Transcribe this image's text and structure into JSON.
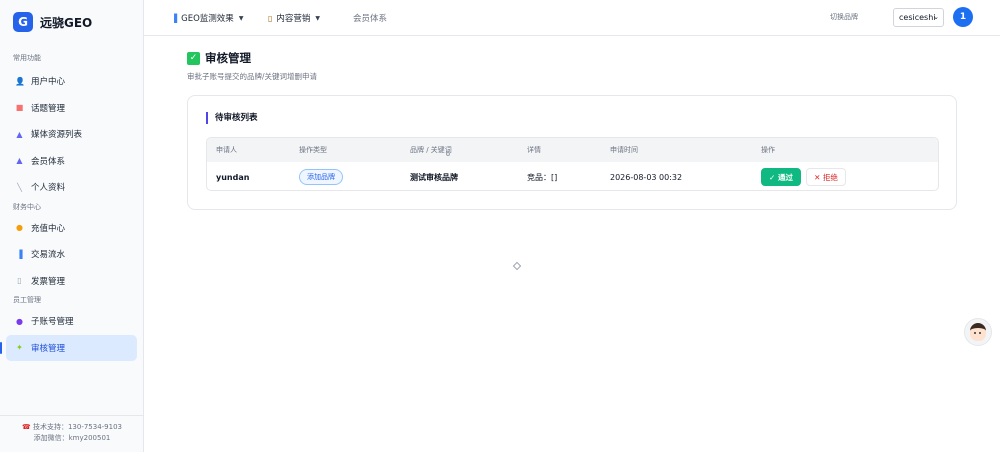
{
  "app": {
    "logo_letter": "G",
    "name": "远骁GEO"
  },
  "sidebar": {
    "sections": [
      {
        "title": "常用功能"
      },
      {
        "title": "财务中心"
      },
      {
        "title": "员工管理"
      }
    ],
    "items": [
      {
        "label": "用户中心",
        "icon": "user-icon"
      },
      {
        "label": "话题管理",
        "icon": "topic-icon"
      },
      {
        "label": "媒体资源列表",
        "icon": "media-icon"
      },
      {
        "label": "会员体系",
        "icon": "member-icon"
      },
      {
        "label": "个人资料",
        "icon": "profile-icon"
      },
      {
        "label": "充值中心",
        "icon": "recharge-icon"
      },
      {
        "label": "交易流水",
        "icon": "chart-icon"
      },
      {
        "label": "发票管理",
        "icon": "invoice-icon"
      },
      {
        "label": "子账号管理",
        "icon": "group-icon"
      },
      {
        "label": "审核管理",
        "icon": "review-icon",
        "active": true
      }
    ],
    "footer": {
      "support": "技术支持：130-7534-9103",
      "wechat": "添加微信：kmy200501"
    }
  },
  "topbar": {
    "menus": [
      {
        "label": "GEO监测效果",
        "icon": "chart-icon"
      },
      {
        "label": "内容营销",
        "icon": "document-icon"
      },
      {
        "label": "会员体系"
      }
    ],
    "brand_label": "切换品牌",
    "brand_value": "cesiceshi",
    "avatar_text": "1"
  },
  "page": {
    "title": "审核管理",
    "subtitle": "审批子账号提交的品牌/关键词增删申请",
    "card_title": "待审核列表",
    "table": {
      "headers": [
        "申请人",
        "操作类型",
        "品牌 / 关键词",
        "详情",
        "申请时间",
        "操作"
      ],
      "rows": [
        {
          "applicant": "yundan",
          "type": "添加品牌",
          "brand": "测试审核品牌",
          "detail": "竞品：[]",
          "time": "2026-08-03 00:32",
          "pass_label": "✓ 通过",
          "reject_label": "✕ 拒绝"
        }
      ]
    }
  },
  "colors": {
    "accent": "#2563eb",
    "success": "#10b981",
    "danger": "#dc2626"
  }
}
